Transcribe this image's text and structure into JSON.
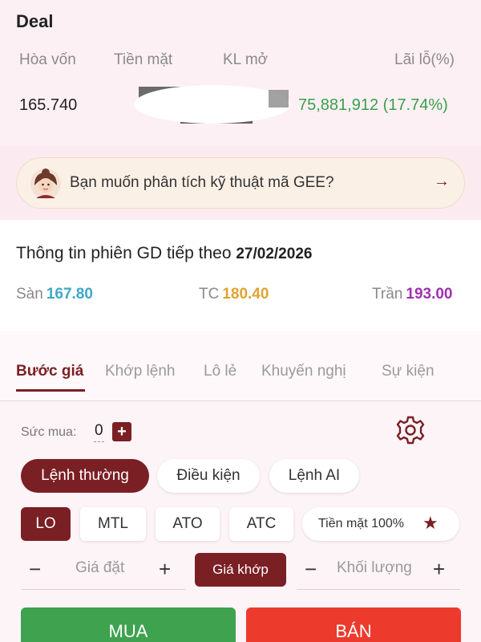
{
  "deal": {
    "title": "Deal",
    "headers": [
      "Hòa vốn",
      "Tiền mặt",
      "KL mở",
      "Lãi lỗ(%)"
    ],
    "breakeven": "165.740",
    "profit": "75,881,912 (17.74%)"
  },
  "banner": {
    "text": "Bạn muốn phân tích kỹ thuật mã GEE?",
    "arrow": "→"
  },
  "session": {
    "title": "Thông tin phiên GD tiếp theo",
    "date": "27/02/2026",
    "floor_label": "Sàn",
    "floor_value": "167.80",
    "ref_label": "TC",
    "ref_value": "180.40",
    "ceil_label": "Trần",
    "ceil_value": "193.00"
  },
  "tabs": [
    "Bước giá",
    "Khớp lệnh",
    "Lô lẻ",
    "Khuyến nghị",
    "Sự kiện"
  ],
  "order": {
    "buying_power_label": "Sức mua:",
    "buying_power_value": "0",
    "plus": "+",
    "modes": [
      "Lệnh thường",
      "Điều kiện",
      "Lệnh AI"
    ],
    "order_types": [
      "LO",
      "MTL",
      "ATO",
      "ATC"
    ],
    "cash_label": "Tiền mặt 100%",
    "cash_star": "★",
    "minus_sign": "−",
    "plus_sign": "+",
    "price_placeholder": "Giá đặt",
    "match_label": "Giá khớp",
    "volume_placeholder": "Khối lượng",
    "buy_label": "MUA",
    "sell_label": "BÁN"
  },
  "colors": {
    "brand": "#7a1f24",
    "profit": "#3aa04a",
    "floor": "#3fa8c4",
    "ref": "#e0a430",
    "ceil": "#a12fb2",
    "buy": "#3ea24e",
    "sell": "#ec3a2d"
  },
  "icons": {
    "avatar": "assistant-avatar-icon",
    "arrow": "arrow-right-icon",
    "gear": "gear-icon",
    "star": "star-icon",
    "plus": "plus-icon"
  }
}
